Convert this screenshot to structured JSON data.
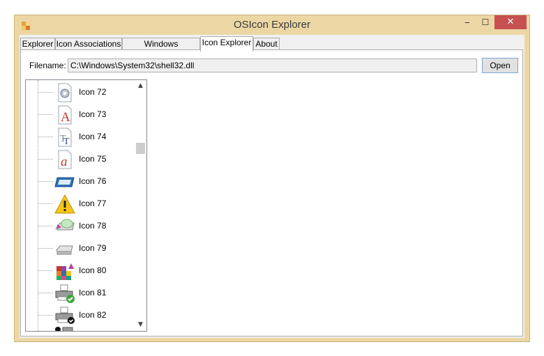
{
  "window": {
    "title": "OSIcon Explorer"
  },
  "controls": {
    "minimize": "‒",
    "maximize": "☐",
    "close": "✕"
  },
  "tabs": [
    {
      "label": "Explorer"
    },
    {
      "label": "Icon Associations"
    },
    {
      "label": "Windows Thumbnails"
    },
    {
      "label": "Icon Explorer",
      "active": true
    },
    {
      "label": "About"
    }
  ],
  "filename": {
    "label": "Filename:",
    "value": "C:\\Windows\\System32\\shell32.dll",
    "open_label": "Open"
  },
  "tree": {
    "items": [
      {
        "label": "Icon 72",
        "icon": "gear-document-icon"
      },
      {
        "label": "Icon 73",
        "icon": "font-a-icon"
      },
      {
        "label": "Icon 74",
        "icon": "truetype-font-icon"
      },
      {
        "label": "Icon 75",
        "icon": "opentype-font-icon"
      },
      {
        "label": "Icon 76",
        "icon": "window-icon"
      },
      {
        "label": "Icon 77",
        "icon": "warning-icon"
      },
      {
        "label": "Icon 78",
        "icon": "cd-drive-icon"
      },
      {
        "label": "Icon 79",
        "icon": "drive-icon"
      },
      {
        "label": "Icon 80",
        "icon": "blocks-icon"
      },
      {
        "label": "Icon 81",
        "icon": "printer-check-icon"
      },
      {
        "label": "Icon 82",
        "icon": "printer-default-icon"
      }
    ]
  },
  "colors": {
    "frame": "#ecd7a4",
    "close": "#c75050"
  }
}
